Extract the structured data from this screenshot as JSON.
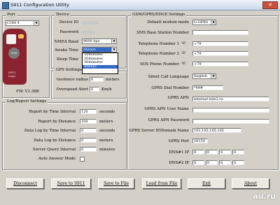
{
  "window": {
    "title": "S911 Configuration Utility",
    "close_glyph": "✕"
  },
  "port": {
    "title": "Port",
    "value": "COM 4",
    "fw": "FW: V1.36B"
  },
  "device": {
    "title": "Device",
    "device_id_label": "Device ID",
    "password_label": "Password",
    "nmea_baud_label": "NMEA Baud",
    "nmea_baud_value": "9600 bps",
    "awake_time_label": "Awake Time",
    "awake_time_value": "Always",
    "sleep_time_label": "Sleep Time",
    "awake_options": [
      "10minutes",
      "20minutes",
      "30minutes",
      "Always"
    ],
    "brand": "S911",
    "brand_sub": "Logo"
  },
  "gps": {
    "title": "GPS Settings",
    "geofence_label": "Geofence radius",
    "geofence_unit": "meters",
    "geofence_value": "0",
    "overspeed_label": "Overspeed Alert",
    "overspeed_unit": "Km/h",
    "overspeed_value": "0"
  },
  "log": {
    "title": "Log/Report Settings",
    "rows": [
      {
        "label": "Report by Time Interval",
        "value": "120",
        "unit": "seconds"
      },
      {
        "label": "Report by Distance",
        "value": "100",
        "unit": "meters"
      },
      {
        "label": "Data Log by Time Interval",
        "value": "0",
        "unit": "seconds"
      },
      {
        "label": "Data Log by Distance",
        "value": "0",
        "unit": "meters"
      },
      {
        "label": "Server Query Interval",
        "value": "0",
        "unit": "minutes"
      }
    ],
    "auto_answer_label": "Auto Answer Mode"
  },
  "gsm": {
    "title": "GSM/GPRS/EDGE Settings",
    "default_mode_label": "Default modem mode",
    "default_mode_value": "G-GPRS",
    "sms_base_label": "SMS Base Station Number",
    "tel1_label": "Telephone Number 1",
    "tel1_value": "+79",
    "tel2_label": "Telephone Number 2",
    "tel2_value": "+79",
    "sos_label": "SOS Phone Number",
    "sos_value": "+79",
    "silent_label": "Silent Call Language",
    "silent_value": "English",
    "gprs_dial_label": "GPRS Dial Number",
    "gprs_dial_value": "*99#",
    "apn_label": "GPRS APN",
    "apn_value": "internet.tele2.ru",
    "apn_user_label": "GPRS APN User Name",
    "apn_pass_label": "GPRS APN Password",
    "server_label": "GPRS Server IP/Domain Name",
    "server_value": "193.193.165.165",
    "port_label": "GPRS Port",
    "port_value": "20150",
    "dns1_label": "DNS#1 IP",
    "dns2_label": "DNS#2 IP",
    "dns_values": [
      "0",
      "0",
      "0",
      "0"
    ]
  },
  "buttons": {
    "disconnect": "Disconnect",
    "save_to_s911": "Save to S911",
    "save_to_file": "Save to File",
    "load_from_file": "Load from File",
    "exit": "Exit",
    "about": "About"
  },
  "watermark": "au.ru"
}
